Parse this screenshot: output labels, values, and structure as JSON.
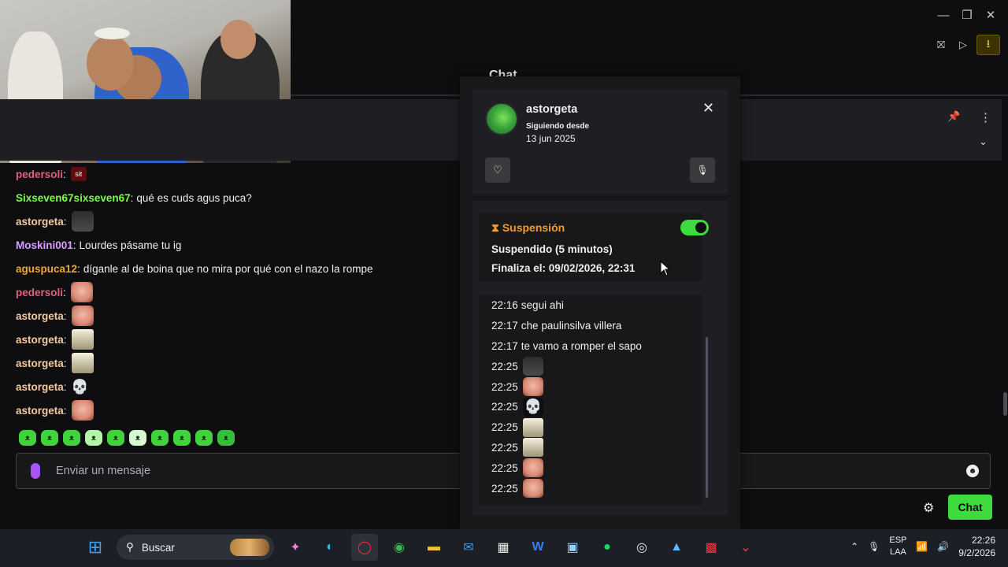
{
  "chat": {
    "header_title": "Chat",
    "input_placeholder": "Enviar un mensaje",
    "chat_button": "Chat",
    "messages": [
      {
        "user": "pedersoli",
        "color": "#e0607e",
        "text": "",
        "emote": "red-sit",
        "emote_text": "sit"
      },
      {
        "user": "Sixseven67sixseven67",
        "color": "#7cfc4c",
        "text": "qué es cuds agus puca?",
        "emote": ""
      },
      {
        "user": "astorgeta",
        "color": "#f5c9a0",
        "text": "",
        "emote": "dark"
      },
      {
        "user": "Moskini001",
        "color": "#d6a0ff",
        "text": "Lourdes pásame tu ig",
        "emote": ""
      },
      {
        "user": "aguspuca12",
        "color": "#f0a830",
        "text": "díganle al de boina que no mira por qué con el nazo la rompe",
        "emote": ""
      },
      {
        "user": "pedersoli",
        "color": "#e0607e",
        "text": "",
        "emote": "face"
      },
      {
        "user": "astorgeta",
        "color": "#f5c9a0",
        "text": "",
        "emote": "face"
      },
      {
        "user": "astorgeta",
        "color": "#f5c9a0",
        "text": "",
        "emote": "poly"
      },
      {
        "user": "astorgeta",
        "color": "#f5c9a0",
        "text": "",
        "emote": "poly"
      },
      {
        "user": "astorgeta",
        "color": "#f5c9a0",
        "text": "",
        "emote": "skull"
      },
      {
        "user": "astorgeta",
        "color": "#f5c9a0",
        "text": "",
        "emote": "face"
      }
    ]
  },
  "user_card": {
    "username": "astorgeta",
    "following_label": "Siguiendo desde",
    "following_date": "13 jun 2025",
    "suspension_title": "Suspensión",
    "suspension_enabled": true,
    "suspension_state": "Suspendido (5 minutos)",
    "suspension_end": "Finaliza el: 09/02/2026, 22:31",
    "history": [
      {
        "time": "22:16",
        "text": "segui ahi",
        "emote": ""
      },
      {
        "time": "22:17",
        "text": "che paulinsilva villera",
        "emote": ""
      },
      {
        "time": "22:17",
        "text": "te vamo a romper el sapo",
        "emote": ""
      },
      {
        "time": "22:25",
        "text": "",
        "emote": "dark"
      },
      {
        "time": "22:25",
        "text": "",
        "emote": "face"
      },
      {
        "time": "22:25",
        "text": "",
        "emote": "skull"
      },
      {
        "time": "22:25",
        "text": "",
        "emote": "poly"
      },
      {
        "time": "22:25",
        "text": "",
        "emote": "poly"
      },
      {
        "time": "22:25",
        "text": "",
        "emote": "face"
      },
      {
        "time": "22:25",
        "text": "",
        "emote": "face"
      }
    ]
  },
  "taskbar": {
    "search_label": "Buscar",
    "lang_top": "ESP",
    "lang_bottom": "LAA",
    "time": "22:26",
    "date": "9/2/2026"
  },
  "colors": {
    "accent_green": "#3ddb3d",
    "suspension_orange": "#f29b2a"
  }
}
